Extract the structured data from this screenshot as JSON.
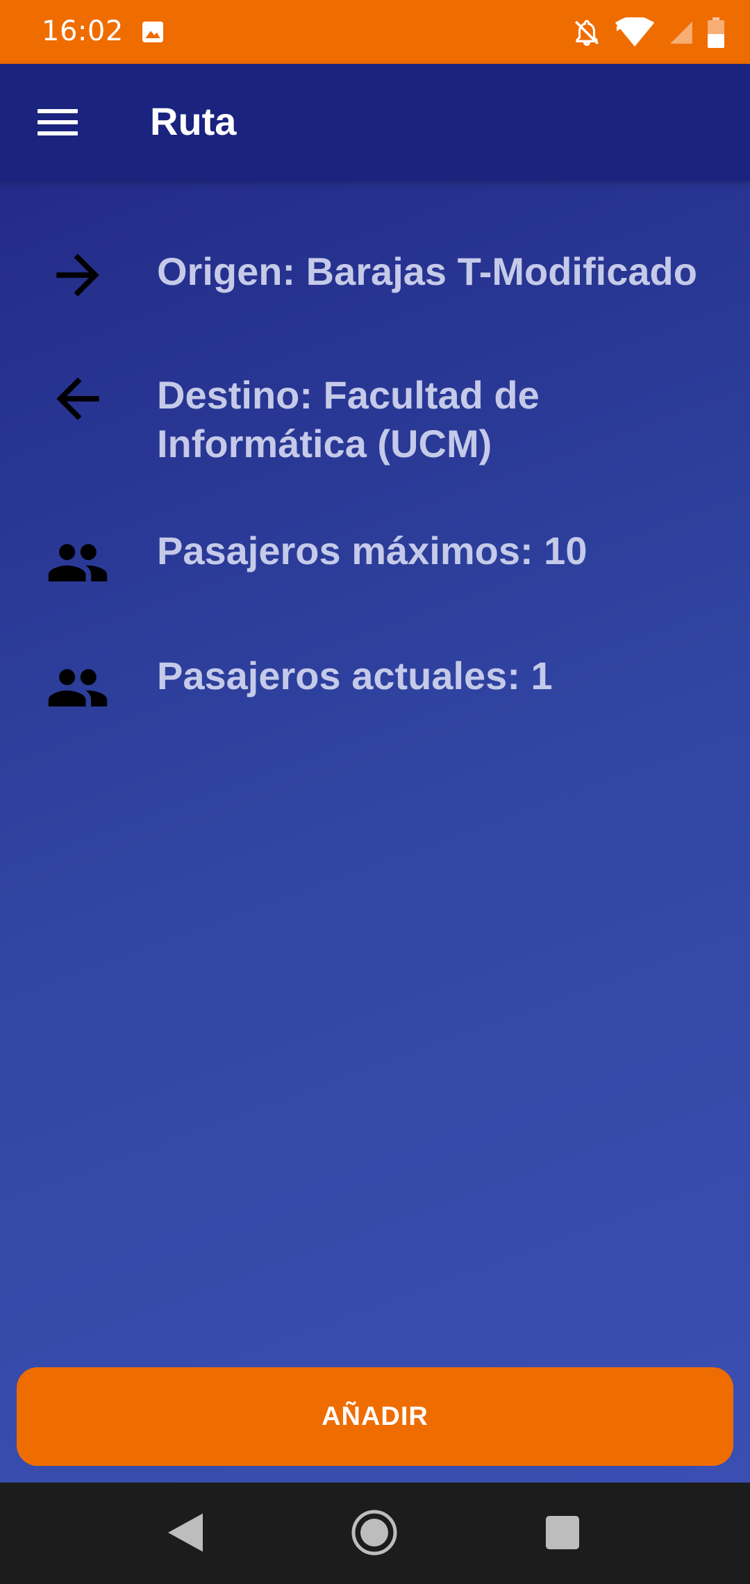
{
  "status_bar": {
    "time": "16:02",
    "bg_color": "#ef6c00",
    "icons": [
      "gallery-icon",
      "bell-off-icon",
      "wifi-icon",
      "signal-icon",
      "battery-icon"
    ]
  },
  "app_bar": {
    "title": "Ruta",
    "bg_color": "#1a237e",
    "menu_icon": "menu-icon"
  },
  "route": {
    "origin": {
      "label": "Origen:  Barajas T-Modificado",
      "icon": "arrow-forward-icon"
    },
    "destination": {
      "label": "Destino: Facultad de Informática (UCM)",
      "icon": "arrow-back-icon"
    },
    "max_passengers": {
      "label": "Pasajeros máximos: 10",
      "icon": "people-icon"
    },
    "current_passengers": {
      "label": "Pasajeros actuales: 1",
      "icon": "people-icon"
    }
  },
  "actions": {
    "add_label": "AÑADIR",
    "accent_color": "#ef6c00"
  },
  "nav_bar": {
    "icons": [
      "back-icon",
      "home-icon",
      "recent-apps-icon"
    ]
  }
}
